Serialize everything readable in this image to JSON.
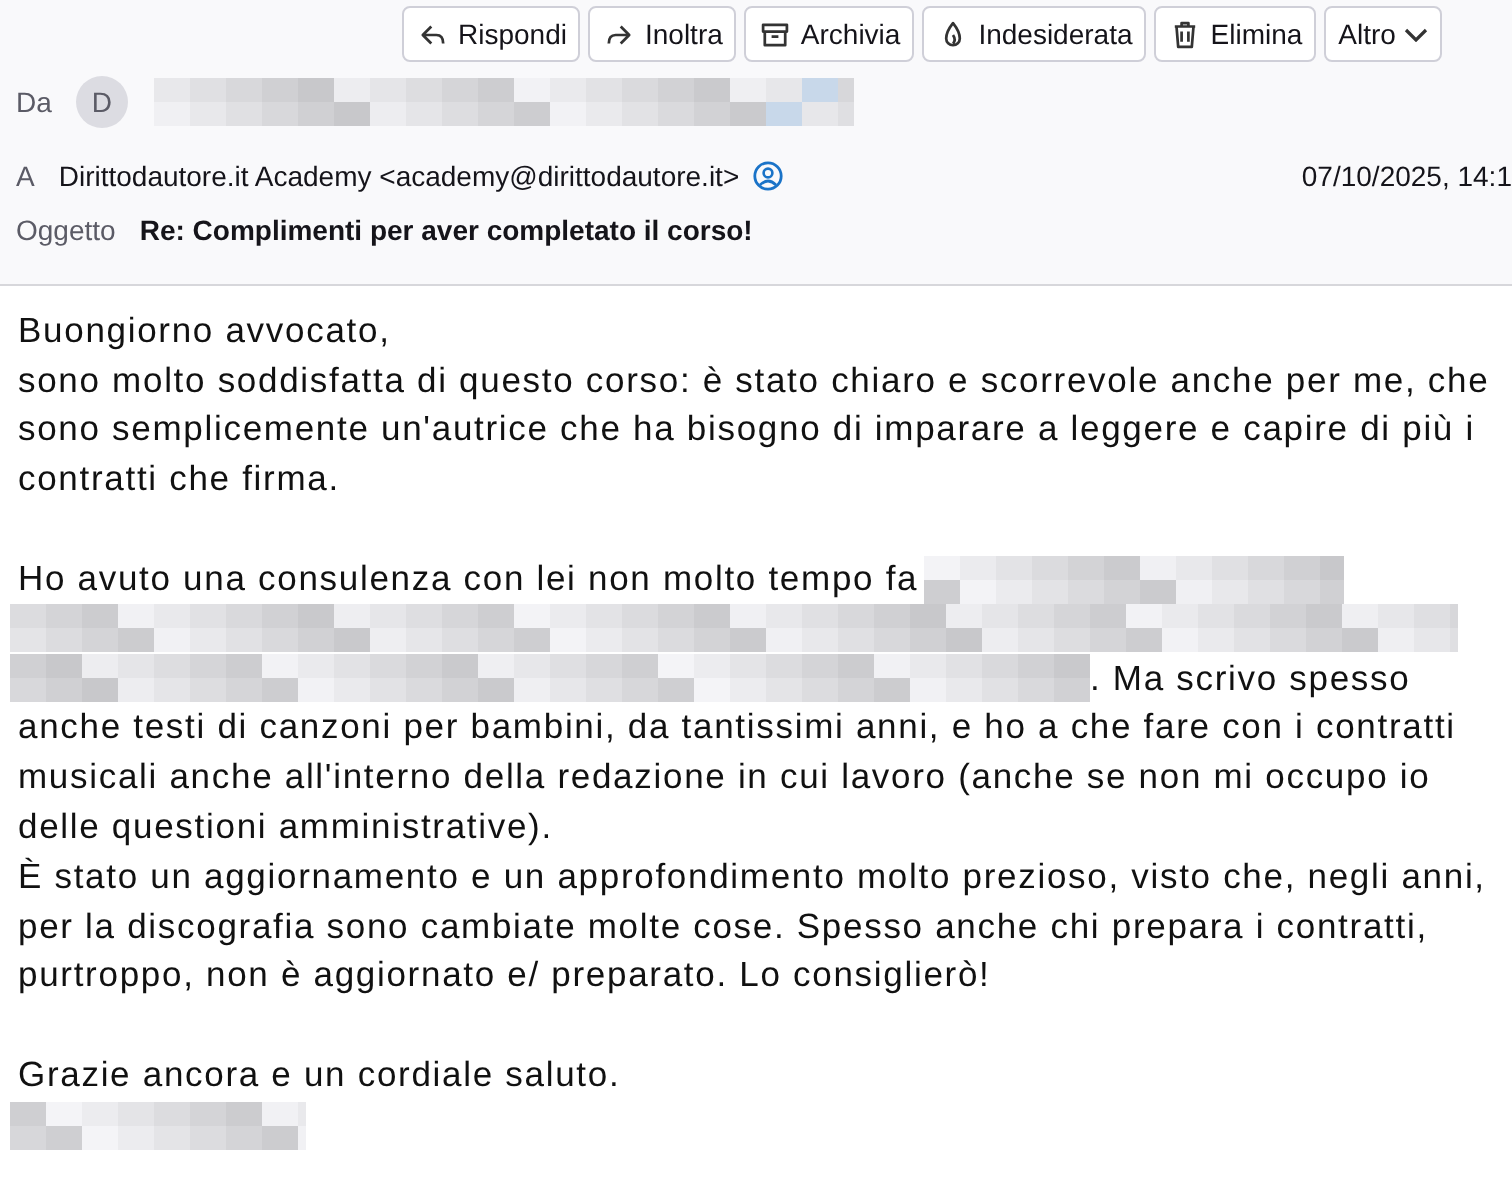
{
  "toolbar": [
    {
      "kind": "reply",
      "label": "Rispondi"
    },
    {
      "kind": "forward",
      "label": "Inoltra"
    },
    {
      "kind": "archive",
      "label": "Archivia"
    },
    {
      "kind": "junk",
      "label": "Indesiderata"
    },
    {
      "kind": "delete",
      "label": "Elimina"
    },
    {
      "kind": "more",
      "label": "Altro"
    }
  ],
  "header": {
    "from_label": "Da",
    "avatar": "D",
    "to_label": "A",
    "to": "Dirittodautore.it Academy <academy@dirittodautore.it>",
    "date": "07/10/2025, 14:1",
    "subject_label": "Oggetto",
    "subject": "Re: Complimenti per aver completato il corso!"
  },
  "body": [
    {
      "lines": [
        [
          {
            "kind": "text",
            "text": "Buongiorno avvocato,"
          }
        ],
        [
          {
            "kind": "text",
            "text": "sono molto soddisfatta di questo corso: è stato chiaro e scorrevole anche per me, che"
          }
        ],
        [
          {
            "kind": "text",
            "text": "sono semplicemente un'autrice che ha bisogno di imparare a leggere e capire di più i"
          }
        ],
        [
          {
            "kind": "text",
            "text": "contratti che firma."
          }
        ]
      ]
    },
    {
      "lines": [
        [
          {
            "kind": "text",
            "text": "Ho avuto una consulenza con lei non molto tempo fa"
          },
          {
            "kind": "redacted"
          }
        ],
        [
          {
            "kind": "redacted"
          }
        ],
        [
          {
            "kind": "redacted"
          },
          {
            "kind": "text",
            "text": ". Ma scrivo spesso"
          }
        ],
        [
          {
            "kind": "text",
            "text": "anche testi di canzoni per bambini, da tantissimi anni, e ho a che fare con i contratti"
          }
        ],
        [
          {
            "kind": "text",
            "text": "musicali anche all'interno della redazione in cui lavoro (anche se non mi occupo io"
          }
        ],
        [
          {
            "kind": "text",
            "text": "delle questioni amministrative)."
          }
        ],
        [
          {
            "kind": "text",
            "text": "È stato un aggiornamento e un approfondimento molto prezioso, visto che, negli anni,"
          }
        ],
        [
          {
            "kind": "text",
            "text": "per la discografia sono cambiate molte cose. Spesso anche chi prepara i contratti,"
          }
        ],
        [
          {
            "kind": "text",
            "text": "purtroppo, non è aggiornato e/ preparato. Lo consiglierò!"
          }
        ]
      ]
    },
    {
      "lines": [
        [
          {
            "kind": "text",
            "text": "Grazie ancora e un cordiale saluto."
          }
        ],
        [
          {
            "kind": "redacted"
          }
        ]
      ]
    }
  ]
}
